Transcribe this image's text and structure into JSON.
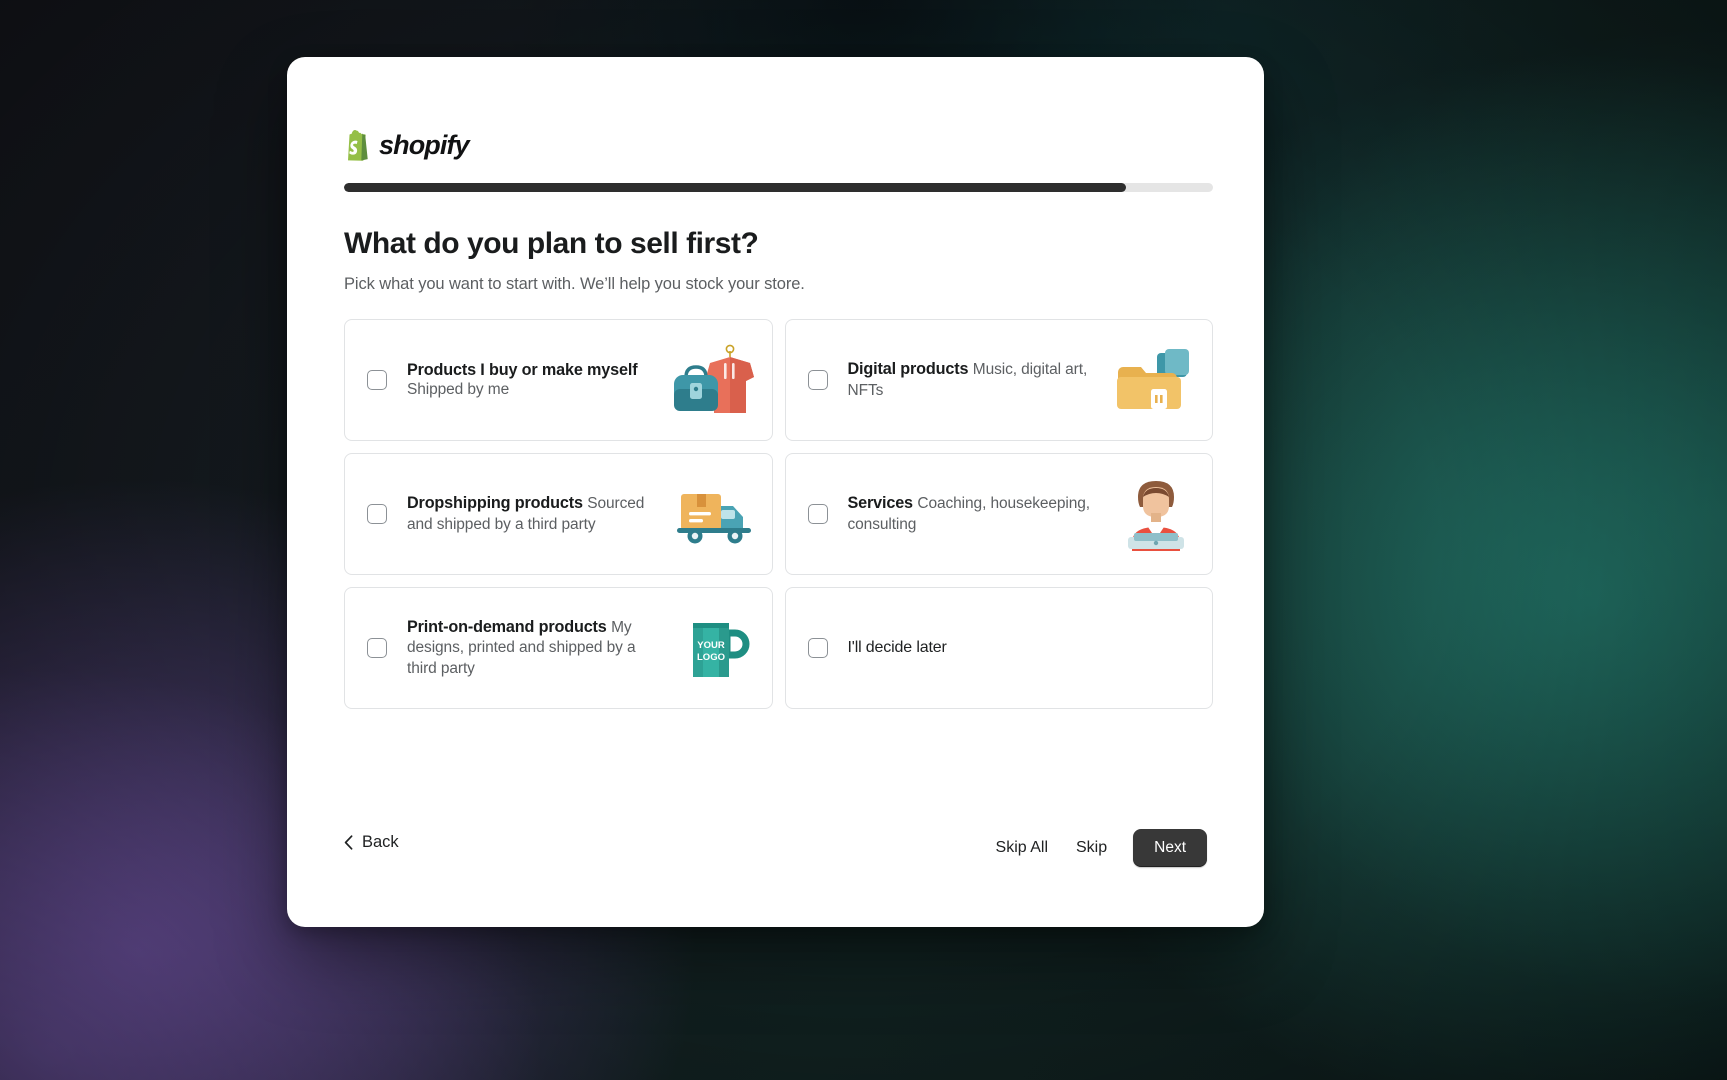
{
  "brand": {
    "name": "shopify",
    "logo_icon": "shopify-bag-icon",
    "accent_green": "#95BF47",
    "accent_green_dark": "#5E8E3E"
  },
  "progress": {
    "percent": 90,
    "fill_color": "#2e2e2e",
    "track_color": "#e5e5e5"
  },
  "heading": {
    "title": "What do you plan to sell first?",
    "subtitle": "Pick what you want to start with. We’ll help you stock your store."
  },
  "options": [
    {
      "id": "products-i-buy-or-make-myself",
      "title": "Products I buy or make myself",
      "desc": "Shipped by me",
      "art": "clothing-and-bag-illustration",
      "checked": false
    },
    {
      "id": "digital-products",
      "title": "Digital products",
      "desc": "Music, digital art, NFTs",
      "art": "folders-illustration",
      "checked": false
    },
    {
      "id": "dropshipping-products",
      "title": "Dropshipping products",
      "desc": "Sourced and shipped by a third party",
      "art": "delivery-truck-illustration",
      "checked": false
    },
    {
      "id": "services",
      "title": "Services",
      "desc": "Coaching, housekeeping, consulting",
      "art": "service-person-illustration",
      "checked": false
    },
    {
      "id": "print-on-demand-products",
      "title": "Print-on-demand products",
      "desc": "My designs, printed and shipped by a third party",
      "art": "logo-mug-illustration",
      "checked": false
    },
    {
      "id": "ill-decide-later",
      "title": "I'll decide later",
      "desc": "",
      "art": "none",
      "checked": false
    }
  ],
  "art_labels": {
    "mug_line1": "YOUR",
    "mug_line2": "LOGO"
  },
  "footer": {
    "back_label": "Back",
    "back_icon": "chevron-left-icon",
    "skip_all_label": "Skip All",
    "skip_label": "Skip",
    "next_label": "Next",
    "next_bg": "#383838"
  }
}
